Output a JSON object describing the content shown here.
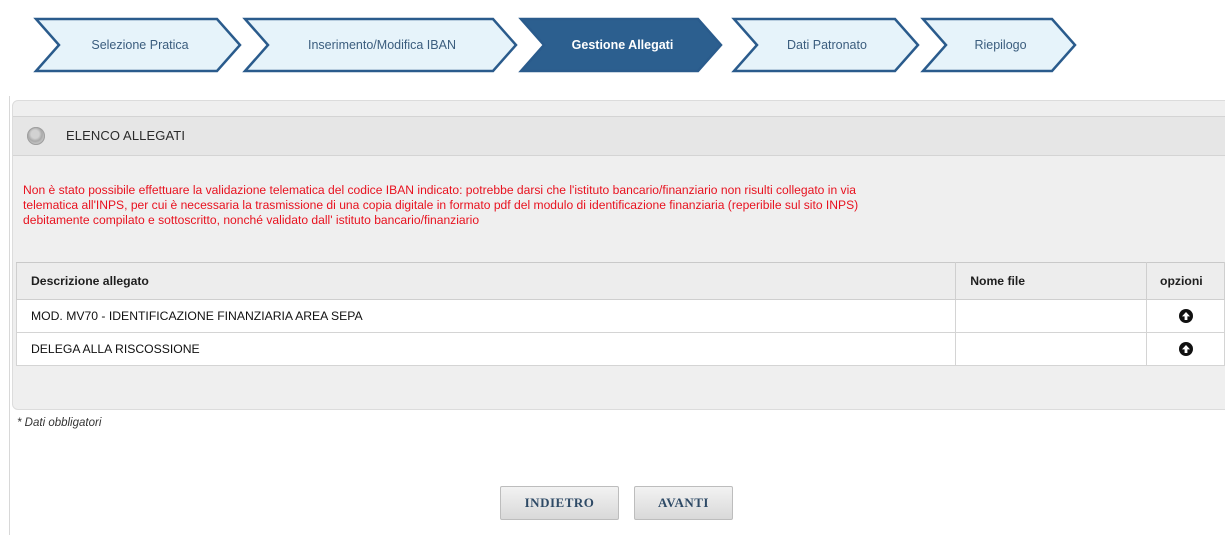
{
  "wizard": {
    "steps": [
      {
        "label": "Selezione Pratica",
        "active": false
      },
      {
        "label": "Inserimento/Modifica IBAN",
        "active": false
      },
      {
        "label": "Gestione Allegati",
        "active": true
      },
      {
        "label": "Dati Patronato",
        "active": false
      },
      {
        "label": "Riepilogo",
        "active": false
      }
    ],
    "colors": {
      "inactive_fill": "#e6f3fa",
      "border": "#2a5b8c",
      "active_fill": "#2c5f8f"
    }
  },
  "panel": {
    "title": "ELENCO ALLEGATI",
    "warning_lines": [
      "Non è stato possibile effettuare la validazione telematica del codice IBAN indicato: potrebbe darsi che l'istituto bancario/finanziario non risulti collegato in via",
      "telematica all'INPS, per cui è necessaria la trasmissione di una copia digitale in formato pdf del modulo di identificazione finanziaria (reperibile sul sito INPS)",
      "debitamente compilato e sottoscritto, nonché validato dall' istituto bancario/finanziario"
    ],
    "table": {
      "headers": [
        "Descrizione allegato",
        "Nome file",
        "opzioni"
      ],
      "rows": [
        {
          "descrizione": "MOD. MV70 - IDENTIFICAZIONE FINANZIARIA AREA SEPA",
          "nome_file": "",
          "icon": "upload-icon"
        },
        {
          "descrizione": "DELEGA ALLA RISCOSSIONE",
          "nome_file": "",
          "icon": "upload-icon"
        }
      ]
    }
  },
  "footnote": "* Dati obbligatori",
  "buttons": {
    "back": "INDIETRO",
    "next": "AVANTI"
  },
  "warning_color": "#e8121f"
}
